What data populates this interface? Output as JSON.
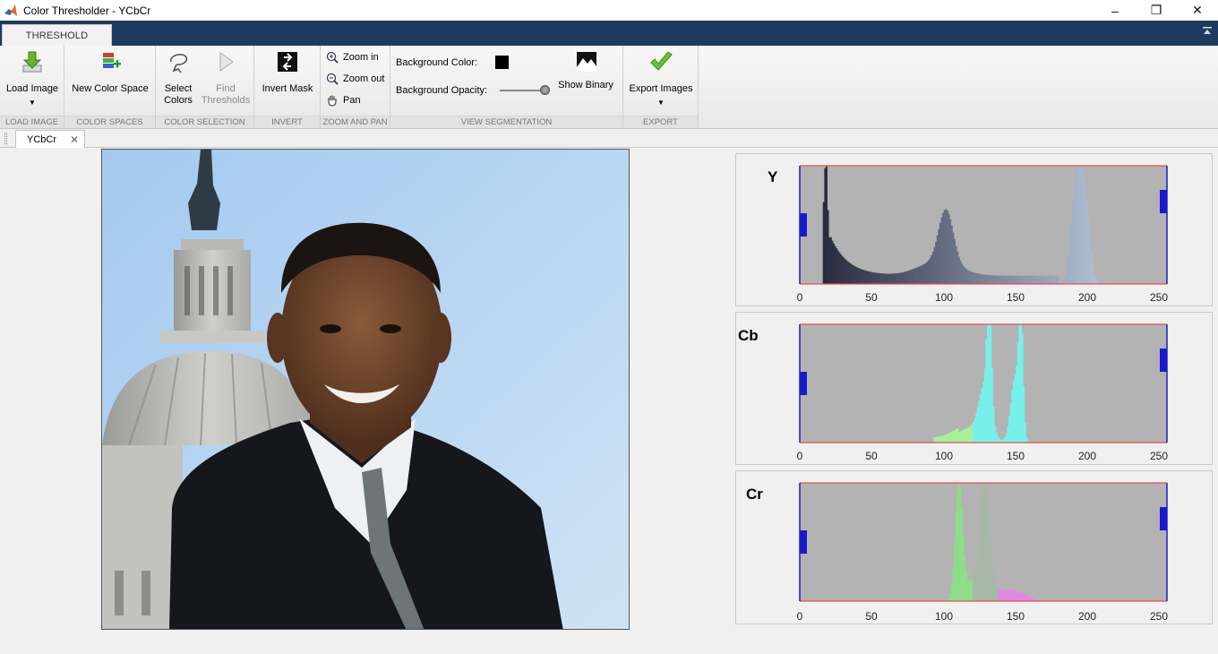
{
  "window": {
    "title": "Color Thresholder - YCbCr",
    "controls": [
      "–",
      "❐",
      "✕"
    ]
  },
  "ribbon": {
    "tab": "THRESHOLD",
    "sections": {
      "load": {
        "label": "LOAD IMAGE",
        "load_image": "Load Image"
      },
      "color_spaces": {
        "label": "COLOR SPACES",
        "new_color_space": "New Color Space"
      },
      "color_selection": {
        "label": "COLOR SELECTION",
        "select_colors_1": "Select",
        "select_colors_2": "Colors",
        "find_thresholds_1": "Find",
        "find_thresholds_2": "Thresholds"
      },
      "invert": {
        "label": "INVERT",
        "invert_mask": "Invert Mask"
      },
      "zoom": {
        "label": "ZOOM AND PAN",
        "zoom_in": "Zoom in",
        "zoom_out": "Zoom out",
        "pan": "Pan"
      },
      "view": {
        "label": "VIEW SEGMENTATION",
        "background_color": "Background Color:",
        "background_color_value": "#000000",
        "background_opacity": "Background Opacity:",
        "background_opacity_value": 1.0,
        "show_binary": "Show Binary"
      },
      "export": {
        "label": "EXPORT",
        "export_images": "Export Images"
      }
    }
  },
  "document_tab": {
    "label": "YCbCr"
  },
  "histograms": [
    {
      "channel": "Y",
      "ticks": [
        "0",
        "50",
        "100",
        "150",
        "200",
        "250"
      ],
      "range": [
        0,
        255
      ],
      "lower_threshold": 0,
      "upper_threshold": 255
    },
    {
      "channel": "Cb",
      "ticks": [
        "0",
        "50",
        "100",
        "150",
        "200",
        "250"
      ],
      "range": [
        0,
        255
      ],
      "lower_threshold": 0,
      "upper_threshold": 255
    },
    {
      "channel": "Cr",
      "ticks": [
        "0",
        "50",
        "100",
        "150",
        "200",
        "250"
      ],
      "range": [
        0,
        255
      ],
      "lower_threshold": 0,
      "upper_threshold": 255
    }
  ],
  "colors": {
    "accent_blue": "#1e3a5f",
    "hist_bg": "#b3b3b3",
    "threshold_handle": "#1a1acc",
    "range_line": "#e05050"
  }
}
